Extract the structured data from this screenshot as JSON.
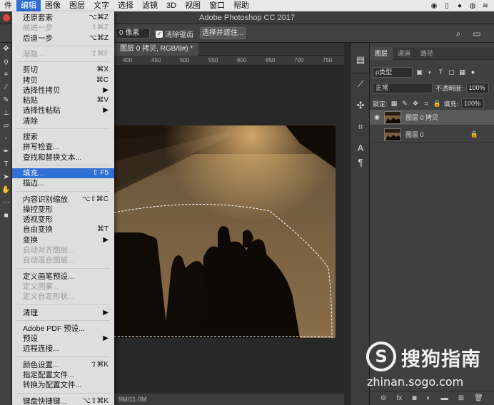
{
  "menubar": {
    "items": [
      "件",
      "编辑",
      "图像",
      "图层",
      "文字",
      "选择",
      "滤镜",
      "3D",
      "视图",
      "窗口",
      "帮助"
    ],
    "active_index": 1
  },
  "window": {
    "title": "Adobe Photoshop CC 2017"
  },
  "options": {
    "feather_value": "0 像素",
    "antialias_label": "消除锯齿",
    "select_mask_label": "选择并遮住..."
  },
  "document": {
    "tab_label": "图层 0 拷贝, RGB/8#) *",
    "ruler_ticks": [
      "400",
      "450",
      "500",
      "550",
      "600",
      "650",
      "700",
      "750"
    ],
    "status": "9M/11.0M"
  },
  "edit_menu": {
    "items": [
      {
        "label": "还原套索",
        "shortcut": "⌥⌘Z",
        "disabled": false
      },
      {
        "label": "前进一步",
        "shortcut": "⇧⌘Z",
        "disabled": true
      },
      {
        "label": "后退一步",
        "shortcut": "⌥⌘Z",
        "disabled": false
      },
      {
        "divider": true
      },
      {
        "label": "渐隐...",
        "shortcut": "⇧⌘F",
        "disabled": true
      },
      {
        "divider": true
      },
      {
        "label": "剪切",
        "shortcut": "⌘X",
        "disabled": false
      },
      {
        "label": "拷贝",
        "shortcut": "⌘C",
        "disabled": false
      },
      {
        "label": "选择性拷贝",
        "shortcut": "▶",
        "disabled": false
      },
      {
        "label": "粘贴",
        "shortcut": "⌘V",
        "disabled": false
      },
      {
        "label": "选择性粘贴",
        "shortcut": "▶",
        "disabled": false
      },
      {
        "label": "清除",
        "shortcut": "",
        "disabled": false
      },
      {
        "divider": true
      },
      {
        "label": "搜索",
        "shortcut": "",
        "disabled": false
      },
      {
        "label": "拼写检查...",
        "shortcut": "",
        "disabled": false
      },
      {
        "label": "查找和替换文本...",
        "shortcut": "",
        "disabled": false
      },
      {
        "divider": true
      },
      {
        "label": "填充...",
        "shortcut": "⇧ F5",
        "disabled": false,
        "highlight": true
      },
      {
        "label": "描边...",
        "shortcut": "",
        "disabled": false
      },
      {
        "divider": true
      },
      {
        "label": "内容识别缩放",
        "shortcut": "⌥⇧⌘C",
        "disabled": false
      },
      {
        "label": "操控变形",
        "shortcut": "",
        "disabled": false
      },
      {
        "label": "透视变形",
        "shortcut": "",
        "disabled": false
      },
      {
        "label": "自由变换",
        "shortcut": "⌘T",
        "disabled": false
      },
      {
        "label": "变换",
        "shortcut": "▶",
        "disabled": false
      },
      {
        "label": "自动对齐图层...",
        "shortcut": "",
        "disabled": true
      },
      {
        "label": "自动混合图层...",
        "shortcut": "",
        "disabled": true
      },
      {
        "divider": true
      },
      {
        "label": "定义画笔预设...",
        "shortcut": "",
        "disabled": false
      },
      {
        "label": "定义图案...",
        "shortcut": "",
        "disabled": true
      },
      {
        "label": "定义自定形状...",
        "shortcut": "",
        "disabled": true
      },
      {
        "divider": true
      },
      {
        "label": "清理",
        "shortcut": "▶",
        "disabled": false
      },
      {
        "divider": true
      },
      {
        "label": "Adobe PDF 预设...",
        "shortcut": "",
        "disabled": false
      },
      {
        "label": "预设",
        "shortcut": "▶",
        "disabled": false
      },
      {
        "label": "远程连接...",
        "shortcut": "",
        "disabled": false
      },
      {
        "divider": true
      },
      {
        "label": "颜色设置...",
        "shortcut": "⇧⌘K",
        "disabled": false
      },
      {
        "label": "指定配置文件...",
        "shortcut": "",
        "disabled": false
      },
      {
        "label": "转换为配置文件...",
        "shortcut": "",
        "disabled": false
      },
      {
        "divider": true
      },
      {
        "label": "键盘快捷键...",
        "shortcut": "⌥⇧⌘K",
        "disabled": false
      }
    ]
  },
  "layers_panel": {
    "tabs": [
      "图层",
      "通道",
      "路径"
    ],
    "active_tab": 0,
    "filter_kind": "ρ类型",
    "blend_mode": "正常",
    "opacity_label": "不透明度:",
    "opacity_value": "100%",
    "lock_label": "锁定:",
    "fill_label": "填充:",
    "fill_value": "100%",
    "layers": [
      {
        "name": "图层 0 拷贝",
        "visible": true,
        "active": true,
        "locked": false
      },
      {
        "name": "图层 0",
        "visible": false,
        "active": false,
        "locked": true
      }
    ],
    "bottom_icons": [
      "link-icon",
      "fx-icon",
      "mask-icon",
      "adjustment-icon",
      "group-icon",
      "new-layer-icon",
      "trash-icon"
    ]
  },
  "watermark": {
    "text": "搜狗指南",
    "url": "zhinan.sogo.com"
  }
}
